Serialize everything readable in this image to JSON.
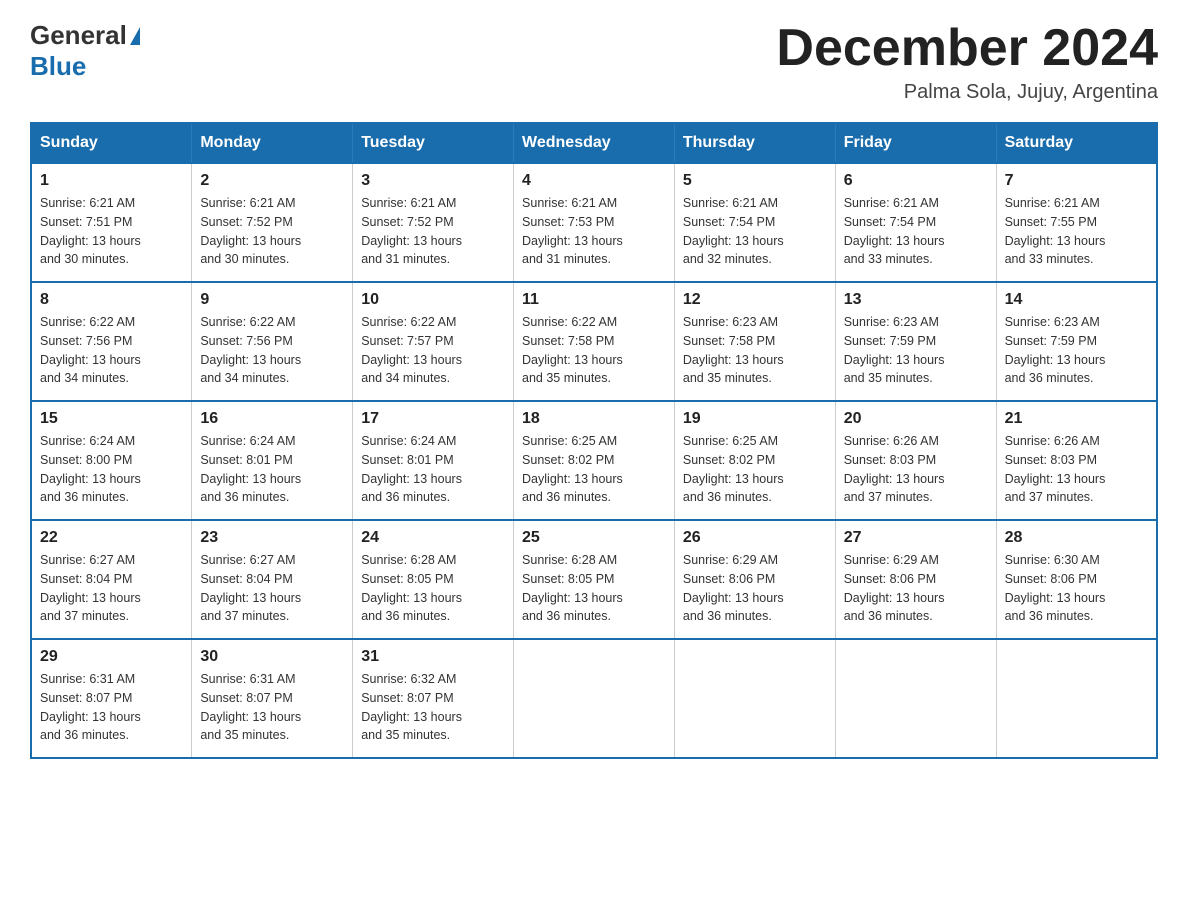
{
  "logo": {
    "general": "General",
    "blue": "Blue"
  },
  "header": {
    "title": "December 2024",
    "subtitle": "Palma Sola, Jujuy, Argentina"
  },
  "days_of_week": [
    "Sunday",
    "Monday",
    "Tuesday",
    "Wednesday",
    "Thursday",
    "Friday",
    "Saturday"
  ],
  "weeks": [
    [
      {
        "num": "1",
        "sunrise": "6:21 AM",
        "sunset": "7:51 PM",
        "daylight": "13 hours and 30 minutes."
      },
      {
        "num": "2",
        "sunrise": "6:21 AM",
        "sunset": "7:52 PM",
        "daylight": "13 hours and 30 minutes."
      },
      {
        "num": "3",
        "sunrise": "6:21 AM",
        "sunset": "7:52 PM",
        "daylight": "13 hours and 31 minutes."
      },
      {
        "num": "4",
        "sunrise": "6:21 AM",
        "sunset": "7:53 PM",
        "daylight": "13 hours and 31 minutes."
      },
      {
        "num": "5",
        "sunrise": "6:21 AM",
        "sunset": "7:54 PM",
        "daylight": "13 hours and 32 minutes."
      },
      {
        "num": "6",
        "sunrise": "6:21 AM",
        "sunset": "7:54 PM",
        "daylight": "13 hours and 33 minutes."
      },
      {
        "num": "7",
        "sunrise": "6:21 AM",
        "sunset": "7:55 PM",
        "daylight": "13 hours and 33 minutes."
      }
    ],
    [
      {
        "num": "8",
        "sunrise": "6:22 AM",
        "sunset": "7:56 PM",
        "daylight": "13 hours and 34 minutes."
      },
      {
        "num": "9",
        "sunrise": "6:22 AM",
        "sunset": "7:56 PM",
        "daylight": "13 hours and 34 minutes."
      },
      {
        "num": "10",
        "sunrise": "6:22 AM",
        "sunset": "7:57 PM",
        "daylight": "13 hours and 34 minutes."
      },
      {
        "num": "11",
        "sunrise": "6:22 AM",
        "sunset": "7:58 PM",
        "daylight": "13 hours and 35 minutes."
      },
      {
        "num": "12",
        "sunrise": "6:23 AM",
        "sunset": "7:58 PM",
        "daylight": "13 hours and 35 minutes."
      },
      {
        "num": "13",
        "sunrise": "6:23 AM",
        "sunset": "7:59 PM",
        "daylight": "13 hours and 35 minutes."
      },
      {
        "num": "14",
        "sunrise": "6:23 AM",
        "sunset": "7:59 PM",
        "daylight": "13 hours and 36 minutes."
      }
    ],
    [
      {
        "num": "15",
        "sunrise": "6:24 AM",
        "sunset": "8:00 PM",
        "daylight": "13 hours and 36 minutes."
      },
      {
        "num": "16",
        "sunrise": "6:24 AM",
        "sunset": "8:01 PM",
        "daylight": "13 hours and 36 minutes."
      },
      {
        "num": "17",
        "sunrise": "6:24 AM",
        "sunset": "8:01 PM",
        "daylight": "13 hours and 36 minutes."
      },
      {
        "num": "18",
        "sunrise": "6:25 AM",
        "sunset": "8:02 PM",
        "daylight": "13 hours and 36 minutes."
      },
      {
        "num": "19",
        "sunrise": "6:25 AM",
        "sunset": "8:02 PM",
        "daylight": "13 hours and 36 minutes."
      },
      {
        "num": "20",
        "sunrise": "6:26 AM",
        "sunset": "8:03 PM",
        "daylight": "13 hours and 37 minutes."
      },
      {
        "num": "21",
        "sunrise": "6:26 AM",
        "sunset": "8:03 PM",
        "daylight": "13 hours and 37 minutes."
      }
    ],
    [
      {
        "num": "22",
        "sunrise": "6:27 AM",
        "sunset": "8:04 PM",
        "daylight": "13 hours and 37 minutes."
      },
      {
        "num": "23",
        "sunrise": "6:27 AM",
        "sunset": "8:04 PM",
        "daylight": "13 hours and 37 minutes."
      },
      {
        "num": "24",
        "sunrise": "6:28 AM",
        "sunset": "8:05 PM",
        "daylight": "13 hours and 36 minutes."
      },
      {
        "num": "25",
        "sunrise": "6:28 AM",
        "sunset": "8:05 PM",
        "daylight": "13 hours and 36 minutes."
      },
      {
        "num": "26",
        "sunrise": "6:29 AM",
        "sunset": "8:06 PM",
        "daylight": "13 hours and 36 minutes."
      },
      {
        "num": "27",
        "sunrise": "6:29 AM",
        "sunset": "8:06 PM",
        "daylight": "13 hours and 36 minutes."
      },
      {
        "num": "28",
        "sunrise": "6:30 AM",
        "sunset": "8:06 PM",
        "daylight": "13 hours and 36 minutes."
      }
    ],
    [
      {
        "num": "29",
        "sunrise": "6:31 AM",
        "sunset": "8:07 PM",
        "daylight": "13 hours and 36 minutes."
      },
      {
        "num": "30",
        "sunrise": "6:31 AM",
        "sunset": "8:07 PM",
        "daylight": "13 hours and 35 minutes."
      },
      {
        "num": "31",
        "sunrise": "6:32 AM",
        "sunset": "8:07 PM",
        "daylight": "13 hours and 35 minutes."
      },
      null,
      null,
      null,
      null
    ]
  ],
  "labels": {
    "sunrise": "Sunrise:",
    "sunset": "Sunset:",
    "daylight": "Daylight:"
  }
}
